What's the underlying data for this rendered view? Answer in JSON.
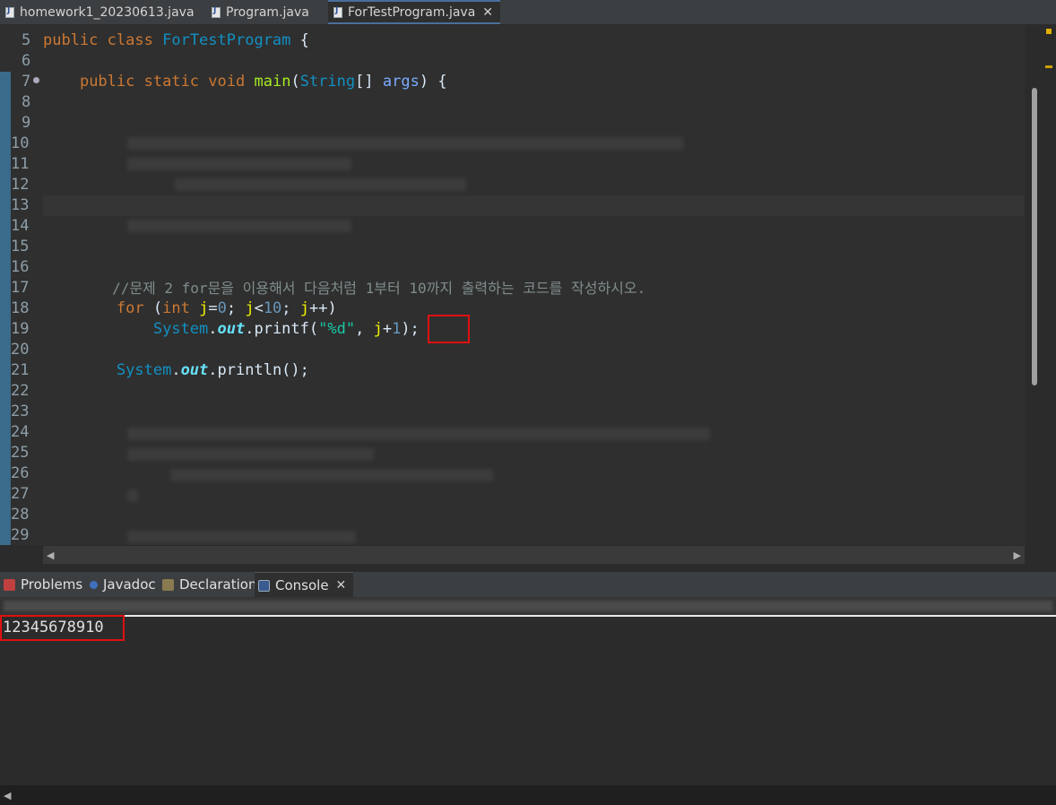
{
  "editor_tabs": [
    {
      "label": "homework1_20230613.java",
      "active": false
    },
    {
      "label": "Program.java",
      "active": false
    },
    {
      "label": "ForTestProgram.java",
      "active": true
    }
  ],
  "tab_close_glyph": "✕",
  "line_numbers": [
    "5",
    "6",
    "7",
    "8",
    "9",
    "10",
    "11",
    "12",
    "13",
    "14",
    "15",
    "16",
    "17",
    "18",
    "19",
    "20",
    "21",
    "22",
    "23",
    "24",
    "25",
    "26",
    "27",
    "28",
    "29"
  ],
  "code": {
    "line5": {
      "kw1": "public",
      "kw2": "class",
      "cls": "ForTestProgram",
      "brace": "{"
    },
    "line7": {
      "kw1": "public",
      "kw2": "static",
      "kw3": "void",
      "fn": "main",
      "p1": "(",
      "cls": "String",
      "arr": "[]",
      "param": "args",
      "p2": ")",
      "brace": "{"
    },
    "line17": {
      "comment": "//문제 2 for문을 이용해서 다음처럼 1부터 10까지 출력하는 코드를 작성하시오."
    },
    "line18": {
      "kw": "for",
      "p1": "(",
      "type": "int",
      "var1": "j",
      "eq": "=",
      "n0": "0",
      "semi1": "; ",
      "var2": "j",
      "lt": "<",
      "n10": "10",
      "semi2": "; ",
      "var3": "j",
      "inc": "++)"
    },
    "line19": {
      "cls": "System",
      "dot1": ".",
      "out": "out",
      "dot2": ".",
      "method": "printf(",
      "str": "\"%d\"",
      "comma": ", ",
      "var": "j",
      "plus": "+",
      "num": "1",
      "end": ");"
    },
    "line21": {
      "cls": "System",
      "dot1": ".",
      "out": "out",
      "dot2": ".",
      "method": "println();"
    }
  },
  "bottom_tabs": [
    {
      "label": "Problems",
      "icon": "problems-icon",
      "active": false
    },
    {
      "label": "Javadoc",
      "icon": "javadoc-icon",
      "active": false
    },
    {
      "label": "Declaration",
      "icon": "declaration-icon",
      "active": false
    },
    {
      "label": "Console",
      "icon": "console-icon",
      "active": true
    }
  ],
  "console_output": "12345678910",
  "colors": {
    "highlight_box": "#e01010",
    "keyword": "#cc7832",
    "class": "#1290c3",
    "string": "#17c6a3"
  }
}
